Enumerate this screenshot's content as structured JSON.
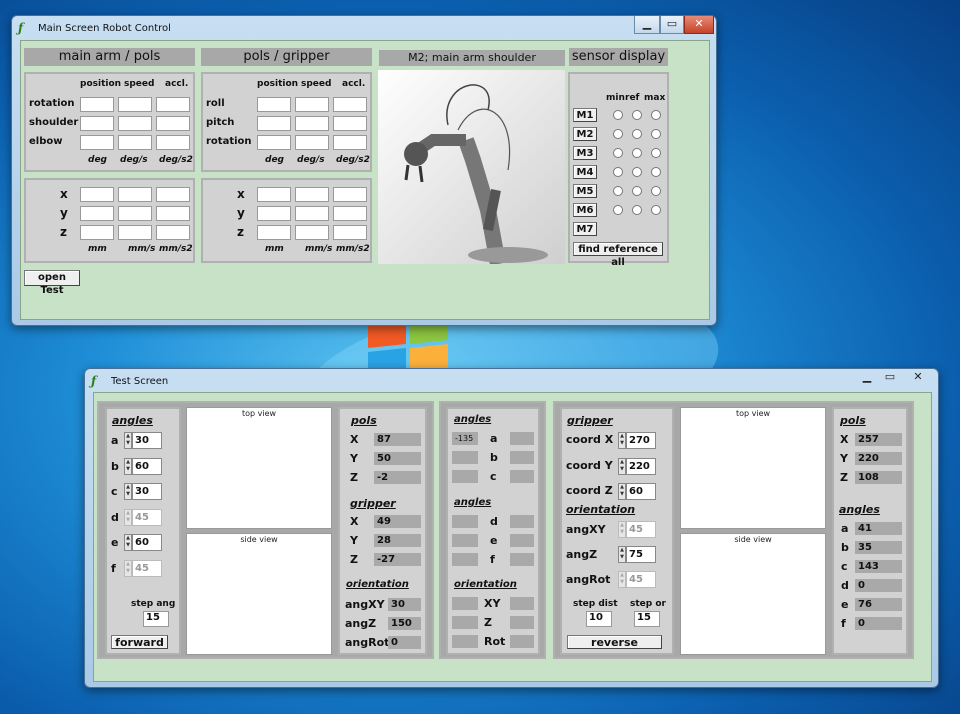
{
  "main": {
    "title": "Main Screen Robot Control",
    "headers": {
      "arm": "main arm / pols",
      "gripper": "pols / gripper",
      "camera": "M2; main arm shoulder",
      "sensor": "sensor display"
    },
    "cols": {
      "position": "position",
      "speed": "speed",
      "accl": "accl."
    },
    "arm_rows": [
      "rotation",
      "shoulder",
      "elbow"
    ],
    "grip_rows": [
      "roll",
      "pitch",
      "rotation"
    ],
    "units_angle": [
      "deg",
      "deg/s",
      "deg/s2"
    ],
    "xyz": [
      "x",
      "y",
      "z"
    ],
    "units_lin": [
      "mm",
      "mm/s",
      "mm/s2"
    ],
    "sensor_cols": {
      "min": "min",
      "ref": "ref",
      "max": "max"
    },
    "motors": [
      "M1",
      "M2",
      "M3",
      "M4",
      "M5",
      "M6",
      "M7"
    ],
    "find_all": "find reference all",
    "open_test": "open Test"
  },
  "test": {
    "title": "Test Screen",
    "p1": {
      "angles_title": "angles",
      "angles": [
        {
          "l": "a",
          "v": "30",
          "dis": false
        },
        {
          "l": "b",
          "v": "60",
          "dis": false
        },
        {
          "l": "c",
          "v": "30",
          "dis": false
        },
        {
          "l": "d",
          "v": "45",
          "dis": true
        },
        {
          "l": "e",
          "v": "60",
          "dis": false
        },
        {
          "l": "f",
          "v": "45",
          "dis": true
        }
      ],
      "step_ang_label": "step ang",
      "step_ang": "15",
      "forward": "forward",
      "top_view": "top view",
      "side_view": "side view",
      "pols_title": "pols",
      "pols": [
        {
          "l": "X",
          "v": "87"
        },
        {
          "l": "Y",
          "v": "50"
        },
        {
          "l": "Z",
          "v": "-2"
        }
      ],
      "gripper_title": "gripper",
      "gripper": [
        {
          "l": "X",
          "v": "49"
        },
        {
          "l": "Y",
          "v": "28"
        },
        {
          "l": "Z",
          "v": "-27"
        }
      ],
      "orient_title": "orientation",
      "orient": [
        {
          "l": "angXY",
          "v": "30"
        },
        {
          "l": "angZ",
          "v": "150"
        },
        {
          "l": "angRot",
          "v": "0"
        }
      ]
    },
    "p2": {
      "angles_title": "angles",
      "a_val": "-135",
      "rows1": [
        "a",
        "b",
        "c"
      ],
      "angles2_title": "angles",
      "rows2": [
        "d",
        "e",
        "f"
      ],
      "orient_title": "orientation",
      "orient": [
        "XY",
        "Z",
        "Rot"
      ]
    },
    "p3": {
      "gripper_title": "gripper",
      "coords": [
        {
          "l": "coord X",
          "v": "270",
          "dis": false
        },
        {
          "l": "coord Y",
          "v": "220",
          "dis": false
        },
        {
          "l": "coord Z",
          "v": "60",
          "dis": false
        }
      ],
      "orient_title": "orientation",
      "orient": [
        {
          "l": "angXY",
          "v": "45",
          "dis": true
        },
        {
          "l": "angZ",
          "v": "75",
          "dis": false
        },
        {
          "l": "angRot",
          "v": "45",
          "dis": true
        }
      ],
      "step_dist_label": "step dist",
      "step_dist": "10",
      "step_or_label": "step or",
      "step_or": "15",
      "reverse": "reverse",
      "top_view": "top view",
      "side_view": "side view",
      "pols_title": "pols",
      "pols": [
        {
          "l": "X",
          "v": "257"
        },
        {
          "l": "Y",
          "v": "220"
        },
        {
          "l": "Z",
          "v": "108"
        }
      ],
      "angles_title": "angles",
      "angles": [
        {
          "l": "a",
          "v": "41"
        },
        {
          "l": "b",
          "v": "35"
        },
        {
          "l": "c",
          "v": "143"
        },
        {
          "l": "d",
          "v": "0"
        },
        {
          "l": "e",
          "v": "76"
        },
        {
          "l": "f",
          "v": "0"
        }
      ]
    }
  }
}
